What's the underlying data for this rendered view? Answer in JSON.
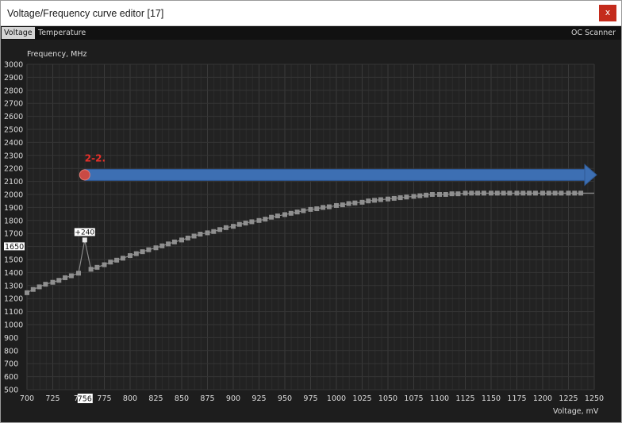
{
  "window": {
    "title": "Voltage/Frequency curve editor [17]",
    "close_label": "x",
    "accent_close": "#c42b1c"
  },
  "tabs": {
    "voltage": "Voltage",
    "temperature": "Temperature",
    "oc_scanner": "OC Scanner"
  },
  "annotation": {
    "label": "2-2.",
    "label_color": "#e8302a",
    "arrow_color": "#3d6fb3",
    "marker_color": "#c94a44",
    "frequency_mhz": 2150,
    "from_voltage_mv": 756,
    "to_voltage_mv": 1250
  },
  "chart_data": {
    "type": "line",
    "xlabel": "Voltage, mV",
    "ylabel": "Frequency, MHz",
    "xlim": [
      700,
      1250
    ],
    "ylim": [
      500,
      3000
    ],
    "xticks": [
      700,
      725,
      750,
      775,
      800,
      825,
      850,
      875,
      900,
      925,
      950,
      975,
      1000,
      1025,
      1050,
      1075,
      1100,
      1125,
      1150,
      1175,
      1200,
      1225,
      1250
    ],
    "yticks": [
      500,
      600,
      700,
      800,
      900,
      1000,
      1100,
      1200,
      1300,
      1400,
      1500,
      1600,
      1700,
      1800,
      1900,
      2000,
      2100,
      2200,
      2300,
      2400,
      2500,
      2600,
      2700,
      2800,
      2900,
      3000
    ],
    "x_tick_labels": [
      "700",
      "725",
      "75",
      "775",
      "800",
      "825",
      "850",
      "875",
      "900",
      "925",
      "950",
      "975",
      "1000",
      "1025",
      "1050",
      "1075",
      "1100",
      "1125",
      "1150",
      "1175",
      "1200",
      "1225",
      "1250"
    ],
    "grid": true,
    "series": [
      {
        "x": [
          700,
          706,
          712,
          718,
          725,
          731,
          737,
          743,
          750,
          756,
          762,
          768,
          775,
          781,
          787,
          793,
          800,
          806,
          812,
          818,
          825,
          831,
          837,
          843,
          850,
          856,
          862,
          868,
          875,
          881,
          887,
          893,
          900,
          906,
          912,
          918,
          925,
          931,
          937,
          943,
          950,
          956,
          962,
          968,
          975,
          981,
          987,
          993,
          1000,
          1006,
          1012,
          1018,
          1025,
          1031,
          1037,
          1043,
          1050,
          1056,
          1062,
          1068,
          1075,
          1081,
          1087,
          1093,
          1100,
          1106,
          1112,
          1118,
          1125,
          1131,
          1137,
          1143,
          1150,
          1156,
          1162,
          1168,
          1175,
          1181,
          1187,
          1193,
          1200,
          1206,
          1212,
          1218,
          1225,
          1231,
          1237,
          1250
        ],
        "y": [
          1245,
          1270,
          1290,
          1310,
          1325,
          1340,
          1360,
          1375,
          1395,
          1650,
          1425,
          1440,
          1460,
          1480,
          1495,
          1510,
          1530,
          1545,
          1560,
          1575,
          1590,
          1605,
          1620,
          1635,
          1650,
          1665,
          1680,
          1695,
          1705,
          1715,
          1730,
          1745,
          1755,
          1770,
          1780,
          1790,
          1800,
          1810,
          1825,
          1835,
          1845,
          1855,
          1865,
          1875,
          1885,
          1890,
          1900,
          1905,
          1915,
          1920,
          1930,
          1935,
          1940,
          1950,
          1955,
          1960,
          1965,
          1970,
          1975,
          1980,
          1985,
          1990,
          1995,
          2000,
          2000,
          2000,
          2005,
          2005,
          2010,
          2010,
          2010,
          2010,
          2010,
          2010,
          2010,
          2010,
          2010,
          2010,
          2010,
          2010,
          2010,
          2010,
          2010,
          2010,
          2010,
          2010,
          2010,
          2010
        ]
      }
    ],
    "highlight_point": {
      "voltage_mv": 756,
      "frequency_mhz": 1650,
      "offset_label": "+240",
      "y_axis_tag": "1650",
      "x_axis_tag": "756"
    }
  }
}
